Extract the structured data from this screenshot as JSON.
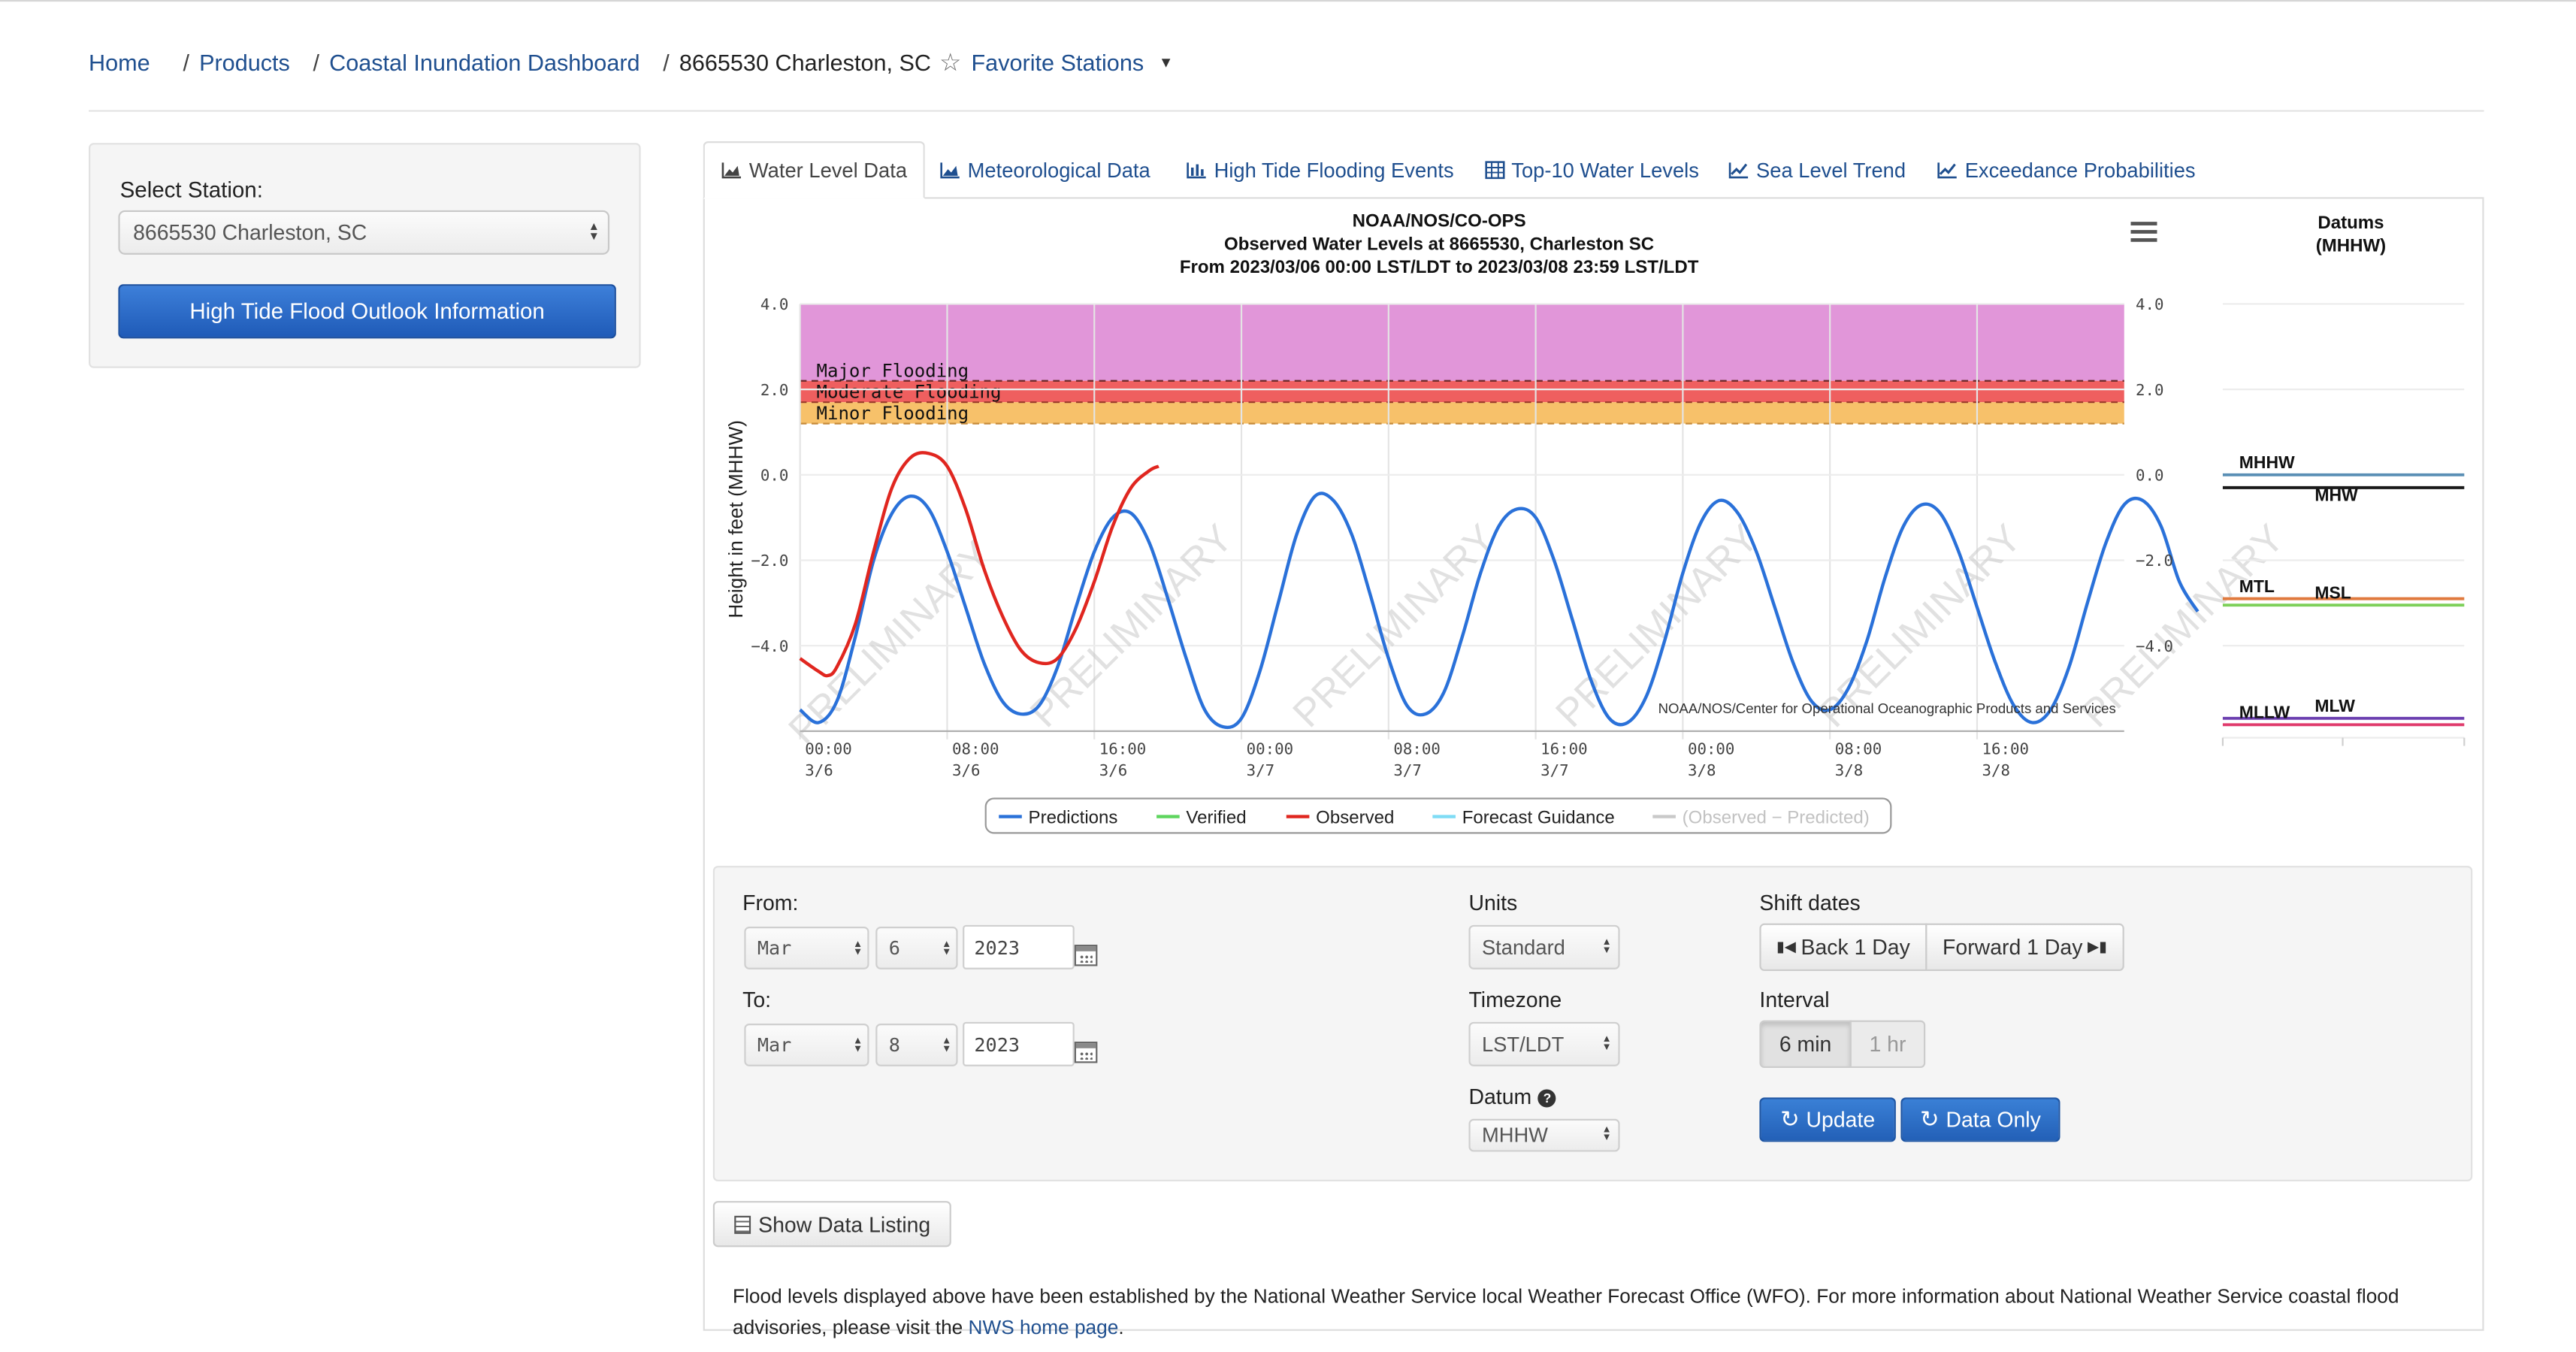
{
  "breadcrumb": {
    "home": "Home",
    "products": "Products",
    "dashboard": "Coastal Inundation Dashboard",
    "sep": "/",
    "current": "8665530 Charleston, SC",
    "favorite": "Favorite Stations"
  },
  "sidebar": {
    "select_label": "Select Station:",
    "station_value": "8665530 Charleston, SC",
    "outlook_button": "High Tide Flood Outlook Information"
  },
  "tabs": [
    {
      "label": "Water Level Data",
      "icon": "area-chart-icon"
    },
    {
      "label": "Meteorological Data",
      "icon": "area-chart-icon"
    },
    {
      "label": "High Tide Flooding Events",
      "icon": "bar-chart-icon"
    },
    {
      "label": "Top-10 Water Levels",
      "icon": "table-icon"
    },
    {
      "label": "Sea Level Trend",
      "icon": "line-chart-icon"
    },
    {
      "label": "Exceedance Probabilities",
      "icon": "line-chart-icon"
    }
  ],
  "chart_data": {
    "type": "line",
    "title": "NOAA/NOS/CO-OPS",
    "subtitle": "Observed Water Levels at 8665530, Charleston SC",
    "subtitle2": "From 2023/03/06 00:00 LST/LDT to 2023/03/08 23:59 LST/LDT",
    "ylabel": "Height in feet (MHHW)",
    "ylim": [
      -6,
      4
    ],
    "yticks": [
      "4.0",
      "2.0",
      "0.0",
      "−2.0",
      "−4.0"
    ],
    "xticks": [
      {
        "t": "00:00",
        "d": "3/6",
        "h": 0
      },
      {
        "t": "08:00",
        "d": "3/6",
        "h": 8
      },
      {
        "t": "16:00",
        "d": "3/6",
        "h": 16
      },
      {
        "t": "00:00",
        "d": "3/7",
        "h": 24
      },
      {
        "t": "08:00",
        "d": "3/7",
        "h": 32
      },
      {
        "t": "16:00",
        "d": "3/7",
        "h": 40
      },
      {
        "t": "00:00",
        "d": "3/8",
        "h": 48
      },
      {
        "t": "08:00",
        "d": "3/8",
        "h": 56
      },
      {
        "t": "16:00",
        "d": "3/8",
        "h": 64
      }
    ],
    "xlim_hours": [
      0,
      72
    ],
    "flood_bands": {
      "major_label": "Major Flooding",
      "moderate_label": "Moderate Flooding",
      "minor_label": "Minor Flooding",
      "major_threshold": 2.2,
      "moderate_threshold": 1.7,
      "minor_threshold": 1.2,
      "major_color": "#e196d9",
      "moderate_color": "#ef5f5f",
      "minor_color": "#f7c16a"
    },
    "series": [
      {
        "name": "Predictions",
        "color": "#2a71d9",
        "points": [
          [
            0,
            -5.5
          ],
          [
            1,
            -5.8
          ],
          [
            2,
            -5.3
          ],
          [
            3,
            -3.8
          ],
          [
            4,
            -2.0
          ],
          [
            5,
            -0.9
          ],
          [
            6,
            -0.5
          ],
          [
            7,
            -0.8
          ],
          [
            8,
            -1.8
          ],
          [
            9,
            -3.1
          ],
          [
            10,
            -4.4
          ],
          [
            11,
            -5.3
          ],
          [
            12,
            -5.6
          ],
          [
            13,
            -5.4
          ],
          [
            14,
            -4.5
          ],
          [
            15,
            -3.1
          ],
          [
            16,
            -1.8
          ],
          [
            17,
            -1.0
          ],
          [
            18,
            -0.9
          ],
          [
            19,
            -1.6
          ],
          [
            20,
            -2.9
          ],
          [
            21,
            -4.3
          ],
          [
            22,
            -5.5
          ],
          [
            23,
            -5.9
          ],
          [
            24,
            -5.7
          ],
          [
            25,
            -4.6
          ],
          [
            26,
            -3.0
          ],
          [
            27,
            -1.4
          ],
          [
            28,
            -0.5
          ],
          [
            29,
            -0.6
          ],
          [
            30,
            -1.4
          ],
          [
            31,
            -2.8
          ],
          [
            32,
            -4.3
          ],
          [
            33,
            -5.4
          ],
          [
            34,
            -5.6
          ],
          [
            35,
            -5.1
          ],
          [
            36,
            -3.8
          ],
          [
            37,
            -2.3
          ],
          [
            38,
            -1.2
          ],
          [
            39,
            -0.8
          ],
          [
            40,
            -1.0
          ],
          [
            41,
            -2.0
          ],
          [
            42,
            -3.4
          ],
          [
            43,
            -4.8
          ],
          [
            44,
            -5.7
          ],
          [
            45,
            -5.8
          ],
          [
            46,
            -5.2
          ],
          [
            47,
            -3.9
          ],
          [
            48,
            -2.3
          ],
          [
            49,
            -1.1
          ],
          [
            50,
            -0.6
          ],
          [
            51,
            -0.9
          ],
          [
            52,
            -1.8
          ],
          [
            53,
            -3.1
          ],
          [
            54,
            -4.4
          ],
          [
            55,
            -5.3
          ],
          [
            56,
            -5.5
          ],
          [
            57,
            -5.0
          ],
          [
            58,
            -3.9
          ],
          [
            59,
            -2.4
          ],
          [
            60,
            -1.2
          ],
          [
            61,
            -0.7
          ],
          [
            62,
            -0.9
          ],
          [
            63,
            -1.8
          ],
          [
            64,
            -3.1
          ],
          [
            65,
            -4.4
          ],
          [
            66,
            -5.4
          ],
          [
            67,
            -5.8
          ],
          [
            68,
            -5.5
          ],
          [
            69,
            -4.5
          ],
          [
            70,
            -3.0
          ],
          [
            71,
            -1.6
          ],
          [
            72,
            -0.7
          ],
          [
            73,
            -0.6
          ],
          [
            74,
            -1.2
          ],
          [
            75,
            -2.5
          ],
          [
            76,
            -3.2
          ]
        ]
      },
      {
        "name": "Observed",
        "color": "#e0261f",
        "points": [
          [
            0,
            -4.3
          ],
          [
            1,
            -4.6
          ],
          [
            1.5,
            -4.7
          ],
          [
            2,
            -4.5
          ],
          [
            3,
            -3.5
          ],
          [
            4,
            -1.8
          ],
          [
            5,
            -0.3
          ],
          [
            6,
            0.4
          ],
          [
            7,
            0.5
          ],
          [
            8,
            0.2
          ],
          [
            9,
            -0.8
          ],
          [
            10,
            -2.2
          ],
          [
            11,
            -3.3
          ],
          [
            12,
            -4.1
          ],
          [
            13,
            -4.4
          ],
          [
            14,
            -4.3
          ],
          [
            15,
            -3.6
          ],
          [
            16,
            -2.5
          ],
          [
            17,
            -1.2
          ],
          [
            18,
            -0.3
          ],
          [
            19,
            0.1
          ],
          [
            19.5,
            0.2
          ]
        ]
      },
      {
        "name": "Verified",
        "color": "#5ed55e",
        "points": []
      },
      {
        "name": "Forecast Guidance",
        "color": "#7fdcf5",
        "points": []
      },
      {
        "name": "(Observed − Predicted)",
        "color": "#c9c9c9",
        "points": []
      }
    ],
    "watermark": "PRELIMINARY",
    "credit": "NOAA/NOS/Center for Operational Oceanographic Products and Services",
    "datums": {
      "title": "Datums",
      "title2": "(MHHW)",
      "lines": [
        {
          "label": "MHHW",
          "value": 0.0,
          "color": "#5a8fb5",
          "side": "left"
        },
        {
          "label": "MHW",
          "value": -0.3,
          "color": "#1a1a1a",
          "side": "right"
        },
        {
          "label": "MTL",
          "value": -2.9,
          "color": "#e07a3e",
          "side": "left"
        },
        {
          "label": "MSL",
          "value": -3.05,
          "color": "#7ed05a",
          "side": "right"
        },
        {
          "label": "MLW",
          "value": -5.7,
          "color": "#6b3fb0",
          "side": "right"
        },
        {
          "label": "MLLW",
          "value": -5.85,
          "color": "#e03a6c",
          "side": "left"
        }
      ]
    }
  },
  "form": {
    "from_label": "From:",
    "to_label": "To:",
    "from": {
      "month": "Mar",
      "day": "6",
      "year": "2023"
    },
    "to": {
      "month": "Mar",
      "day": "8",
      "year": "2023"
    },
    "units_label": "Units",
    "units_value": "Standard",
    "timezone_label": "Timezone",
    "timezone_value": "LST/LDT",
    "datum_label": "Datum",
    "datum_value": "MHHW",
    "shift_label": "Shift dates",
    "back_button": "Back 1 Day",
    "forward_button": "Forward 1 Day",
    "interval_label": "Interval",
    "interval_6min": "6 min",
    "interval_1hr": "1 hr",
    "update_button": "Update",
    "data_only_button": "Data Only"
  },
  "show_listing_button": "Show Data Listing",
  "note": {
    "text": "Flood levels displayed above have been established by the National Weather Service local Weather Forecast Office (WFO). For more information about National Weather Service coastal flood advisories, please visit the ",
    "link": "NWS home page",
    "end": "."
  }
}
